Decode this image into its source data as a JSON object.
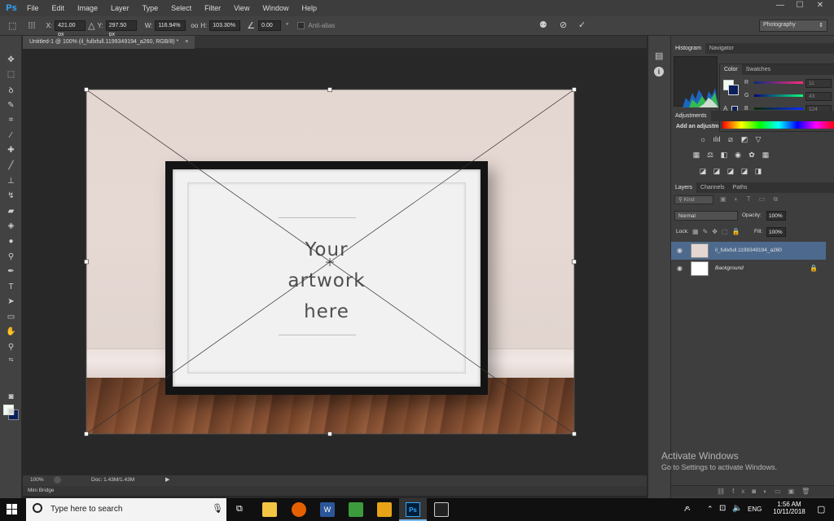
{
  "menubar": {
    "logo": "Ps",
    "items": [
      "File",
      "Edit",
      "Image",
      "Layer",
      "Type",
      "Select",
      "Filter",
      "View",
      "Window",
      "Help"
    ],
    "minimize": "—",
    "maximize": "☐",
    "close": "✕"
  },
  "options": {
    "x_label": "X:",
    "x_value": "421.00 px",
    "y_label": "Y:",
    "y_value": "297.50 px",
    "w_label": "W:",
    "w_value": "116.94%",
    "link": "oo",
    "h_label": "H:",
    "h_value": "103.30%",
    "angle_value": "0.00",
    "degree": "°",
    "antialias_label": "Anti-alias",
    "workspace": "Photography"
  },
  "document": {
    "tab_title": "Untitled-1 @ 100% (il_fullxfull.1199349194_a260, RGB/8) *",
    "tab_close": "×",
    "artwork_line1": "Your",
    "artwork_line2": "artwork",
    "artwork_line3": "here",
    "zoom": "100%",
    "doc_size": "Doc: 1.43M/1.43M",
    "minibridge": "Mini Bridge"
  },
  "panels": {
    "top_tabs": [
      "Histogram",
      "Navigator"
    ],
    "color_tabs": [
      "Color",
      "Swatches"
    ],
    "color": {
      "r_label": "R",
      "r_value": "11",
      "g_label": "G",
      "g_value": "43",
      "b_label": "B",
      "b_value": "124"
    },
    "adjustments_tab": "Adjustments",
    "adjustments_hint": "Add an adjustm",
    "layers_tabs": [
      "Layers",
      "Channels",
      "Paths"
    ],
    "kind_label": "Kind",
    "blend_mode": "Normal",
    "opacity_label": "Opacity:",
    "opacity_value": "100%",
    "lock_label": "Lock:",
    "fill_label": "Fill:",
    "fill_value": "100%",
    "layers": [
      {
        "name": "il_fullxfull.1199349194_a260"
      },
      {
        "name": "Background"
      }
    ]
  },
  "watermark": {
    "line1": "Activate Windows",
    "line2": "Go to Settings to activate Windows."
  },
  "taskbar": {
    "search_placeholder": "Type here to search",
    "lang": "ENG",
    "time": "1:56 AM",
    "date": "10/11/2018"
  },
  "colors": {
    "accent_ps": "#31a8ff",
    "foreground": "#f2fbf1",
    "background": "#0a1f5b"
  }
}
